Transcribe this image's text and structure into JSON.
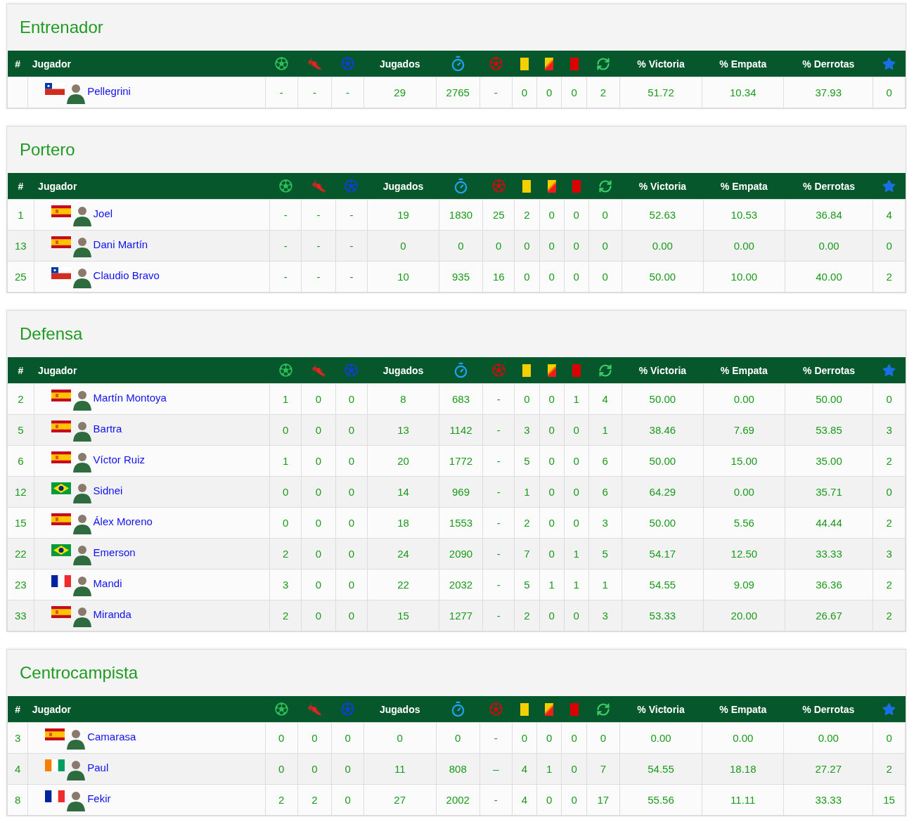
{
  "sections": [
    {
      "title": "Entrenador",
      "header": [
        "#",
        "Jugador",
        "Jugados",
        "% Victoria",
        "% Empata",
        "% Derrotas"
      ],
      "rows": [
        {
          "name": "Pellegrini",
          "kind": "cl",
          "stats": [
            "-",
            "-",
            "-",
            "29",
            "2765",
            "-",
            "0",
            "0",
            "0",
            "2",
            "51.72",
            "10.34",
            "37.93",
            "0"
          ]
        }
      ]
    },
    {
      "title": "Portero",
      "header": [
        "#",
        "Jugador",
        "Jugados",
        "% Victoria",
        "% Empata",
        "% Derrotas"
      ],
      "rows": [
        {
          "number": "1",
          "name": "Joel",
          "kind": "es",
          "stats": [
            "-",
            "-",
            "-",
            "19",
            "1830",
            "25",
            "2",
            "0",
            "0",
            "0",
            "52.63",
            "10.53",
            "36.84",
            "4"
          ]
        },
        {
          "number": "13",
          "name": "Dani Martín",
          "kind": "es",
          "stats": [
            "-",
            "-",
            "-",
            "0",
            "0",
            "0",
            "0",
            "0",
            "0",
            "0",
            "0.00",
            "0.00",
            "0.00",
            "0"
          ]
        },
        {
          "number": "25",
          "name": "Claudio Bravo",
          "kind": "cl",
          "stats": [
            "-",
            "-",
            "-",
            "10",
            "935",
            "16",
            "0",
            "0",
            "0",
            "0",
            "50.00",
            "10.00",
            "40.00",
            "2"
          ]
        }
      ]
    },
    {
      "title": "Defensa",
      "header": [
        "#",
        "Jugador",
        "Jugados",
        "% Victoria",
        "% Empata",
        "% Derrotas"
      ],
      "rows": [
        {
          "number": "2",
          "name": "Martín Montoya",
          "kind": "es",
          "stats": [
            "1",
            "0",
            "0",
            "8",
            "683",
            "-",
            "0",
            "0",
            "1",
            "4",
            "50.00",
            "0.00",
            "50.00",
            "0"
          ]
        },
        {
          "number": "5",
          "name": "Bartra",
          "kind": "es",
          "stats": [
            "0",
            "0",
            "0",
            "13",
            "1142",
            "-",
            "3",
            "0",
            "0",
            "1",
            "38.46",
            "7.69",
            "53.85",
            "3"
          ]
        },
        {
          "number": "6",
          "name": "Víctor Ruiz",
          "kind": "es",
          "stats": [
            "1",
            "0",
            "0",
            "20",
            "1772",
            "-",
            "5",
            "0",
            "0",
            "6",
            "50.00",
            "15.00",
            "35.00",
            "2"
          ]
        },
        {
          "number": "12",
          "name": "Sidnei",
          "kind": "br",
          "stats": [
            "0",
            "0",
            "0",
            "14",
            "969",
            "-",
            "1",
            "0",
            "0",
            "6",
            "64.29",
            "0.00",
            "35.71",
            "0"
          ]
        },
        {
          "number": "15",
          "name": "Álex Moreno",
          "kind": "es",
          "stats": [
            "0",
            "0",
            "0",
            "18",
            "1553",
            "-",
            "2",
            "0",
            "0",
            "3",
            "50.00",
            "5.56",
            "44.44",
            "2"
          ]
        },
        {
          "number": "22",
          "name": "Emerson",
          "kind": "br",
          "stats": [
            "2",
            "0",
            "0",
            "24",
            "2090",
            "-",
            "7",
            "0",
            "1",
            "5",
            "54.17",
            "12.50",
            "33.33",
            "3"
          ]
        },
        {
          "number": "23",
          "name": "Mandi",
          "kind": "fr",
          "stats": [
            "3",
            "0",
            "0",
            "22",
            "2032",
            "-",
            "5",
            "1",
            "1",
            "1",
            "54.55",
            "9.09",
            "36.36",
            "2"
          ]
        },
        {
          "number": "33",
          "name": "Miranda",
          "kind": "es",
          "stats": [
            "2",
            "0",
            "0",
            "15",
            "1277",
            "-",
            "2",
            "0",
            "0",
            "3",
            "53.33",
            "20.00",
            "26.67",
            "2"
          ]
        }
      ]
    },
    {
      "title": "Centrocampista",
      "header": [
        "#",
        "Jugador",
        "Jugados",
        "% Victoria",
        "% Empata",
        "% Derrotas"
      ],
      "rows": [
        {
          "number": "3",
          "name": "Camarasa",
          "kind": "es",
          "stats": [
            "0",
            "0",
            "0",
            "0",
            "0",
            "-",
            "0",
            "0",
            "0",
            "0",
            "0.00",
            "0.00",
            "0.00",
            "0"
          ]
        },
        {
          "number": "4",
          "name": "Paul",
          "kind": "ci",
          "stats": [
            "0",
            "0",
            "0",
            "11",
            "808",
            "–",
            "4",
            "1",
            "0",
            "7",
            "54.55",
            "18.18",
            "27.27",
            "2"
          ]
        },
        {
          "number": "8",
          "name": "Fekir",
          "kind": "fr",
          "stats": [
            "2",
            "2",
            "0",
            "27",
            "2002",
            "-",
            "4",
            "0",
            "0",
            "17",
            "55.56",
            "11.11",
            "33.33",
            "15"
          ]
        }
      ]
    }
  ]
}
